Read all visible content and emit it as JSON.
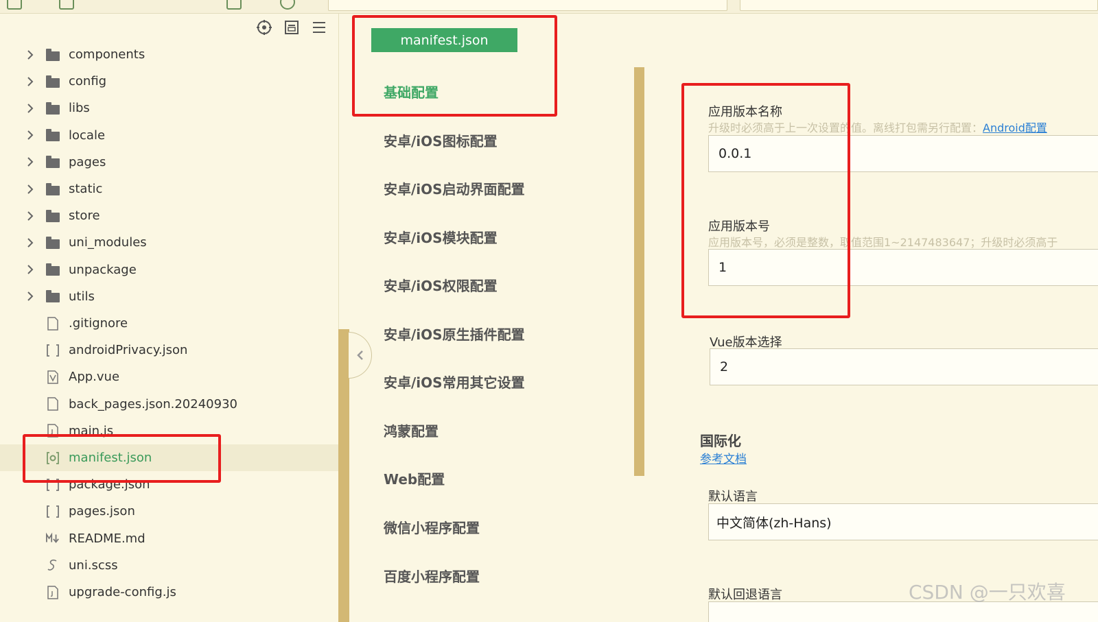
{
  "toolbar": {
    "address_placeholder": ""
  },
  "sidebar": {
    "tool_icons": [
      "locate-icon",
      "collapse-all-icon",
      "menu-icon"
    ],
    "items": [
      {
        "label": "components",
        "type": "folder"
      },
      {
        "label": "config",
        "type": "folder"
      },
      {
        "label": "libs",
        "type": "folder"
      },
      {
        "label": "locale",
        "type": "folder"
      },
      {
        "label": "pages",
        "type": "folder"
      },
      {
        "label": "static",
        "type": "folder"
      },
      {
        "label": "store",
        "type": "folder"
      },
      {
        "label": "uni_modules",
        "type": "folder"
      },
      {
        "label": "unpackage",
        "type": "folder"
      },
      {
        "label": "utils",
        "type": "folder"
      },
      {
        "label": ".gitignore",
        "type": "file"
      },
      {
        "label": "androidPrivacy.json",
        "type": "json"
      },
      {
        "label": "App.vue",
        "type": "vue"
      },
      {
        "label": "back_pages.json.20240930",
        "type": "file"
      },
      {
        "label": "main.js",
        "type": "js"
      },
      {
        "label": "manifest.json",
        "type": "manifest",
        "selected": true
      },
      {
        "label": "package.json",
        "type": "json"
      },
      {
        "label": "pages.json",
        "type": "json"
      },
      {
        "label": "README.md",
        "type": "md"
      },
      {
        "label": "uni.scss",
        "type": "scss"
      },
      {
        "label": "upgrade-config.js",
        "type": "js"
      }
    ]
  },
  "nav": {
    "tab_label": "manifest.json",
    "items": [
      {
        "label": "基础配置",
        "active": true
      },
      {
        "label": "安卓/iOS图标配置"
      },
      {
        "label": "安卓/iOS启动界面配置"
      },
      {
        "label": "安卓/iOS模块配置"
      },
      {
        "label": "安卓/iOS权限配置"
      },
      {
        "label": "安卓/iOS原生插件配置"
      },
      {
        "label": "安卓/iOS常用其它设置"
      },
      {
        "label": "鸿蒙配置"
      },
      {
        "label": "Web配置"
      },
      {
        "label": "微信小程序配置"
      },
      {
        "label": "百度小程序配置"
      }
    ]
  },
  "form": {
    "version_name": {
      "label": "应用版本名称",
      "hint": "升级时必须高于上一次设置的值。离线打包需另行配置：",
      "hint_link": "Android配置",
      "value": "0.0.1"
    },
    "version_code": {
      "label": "应用版本号",
      "hint": "应用版本号，必须是整数，取值范围1~2147483647；升级时必须高于",
      "value": "1"
    },
    "vue_version": {
      "label": "Vue版本选择",
      "value": "2"
    },
    "i18n": {
      "title": "国际化",
      "link": "参考文档",
      "default_lang_label": "默认语言",
      "default_lang_value": "中文简体(zh-Hans)",
      "fallback_lang_label": "默认回退语言"
    }
  },
  "watermark": "CSDN @一只欢喜",
  "colors": {
    "background": "#fbf7e3",
    "accent_green": "#3fa865",
    "scrollbar": "#d3b874",
    "highlight_red": "#e81e1e",
    "link_blue": "#2a7fd4"
  }
}
